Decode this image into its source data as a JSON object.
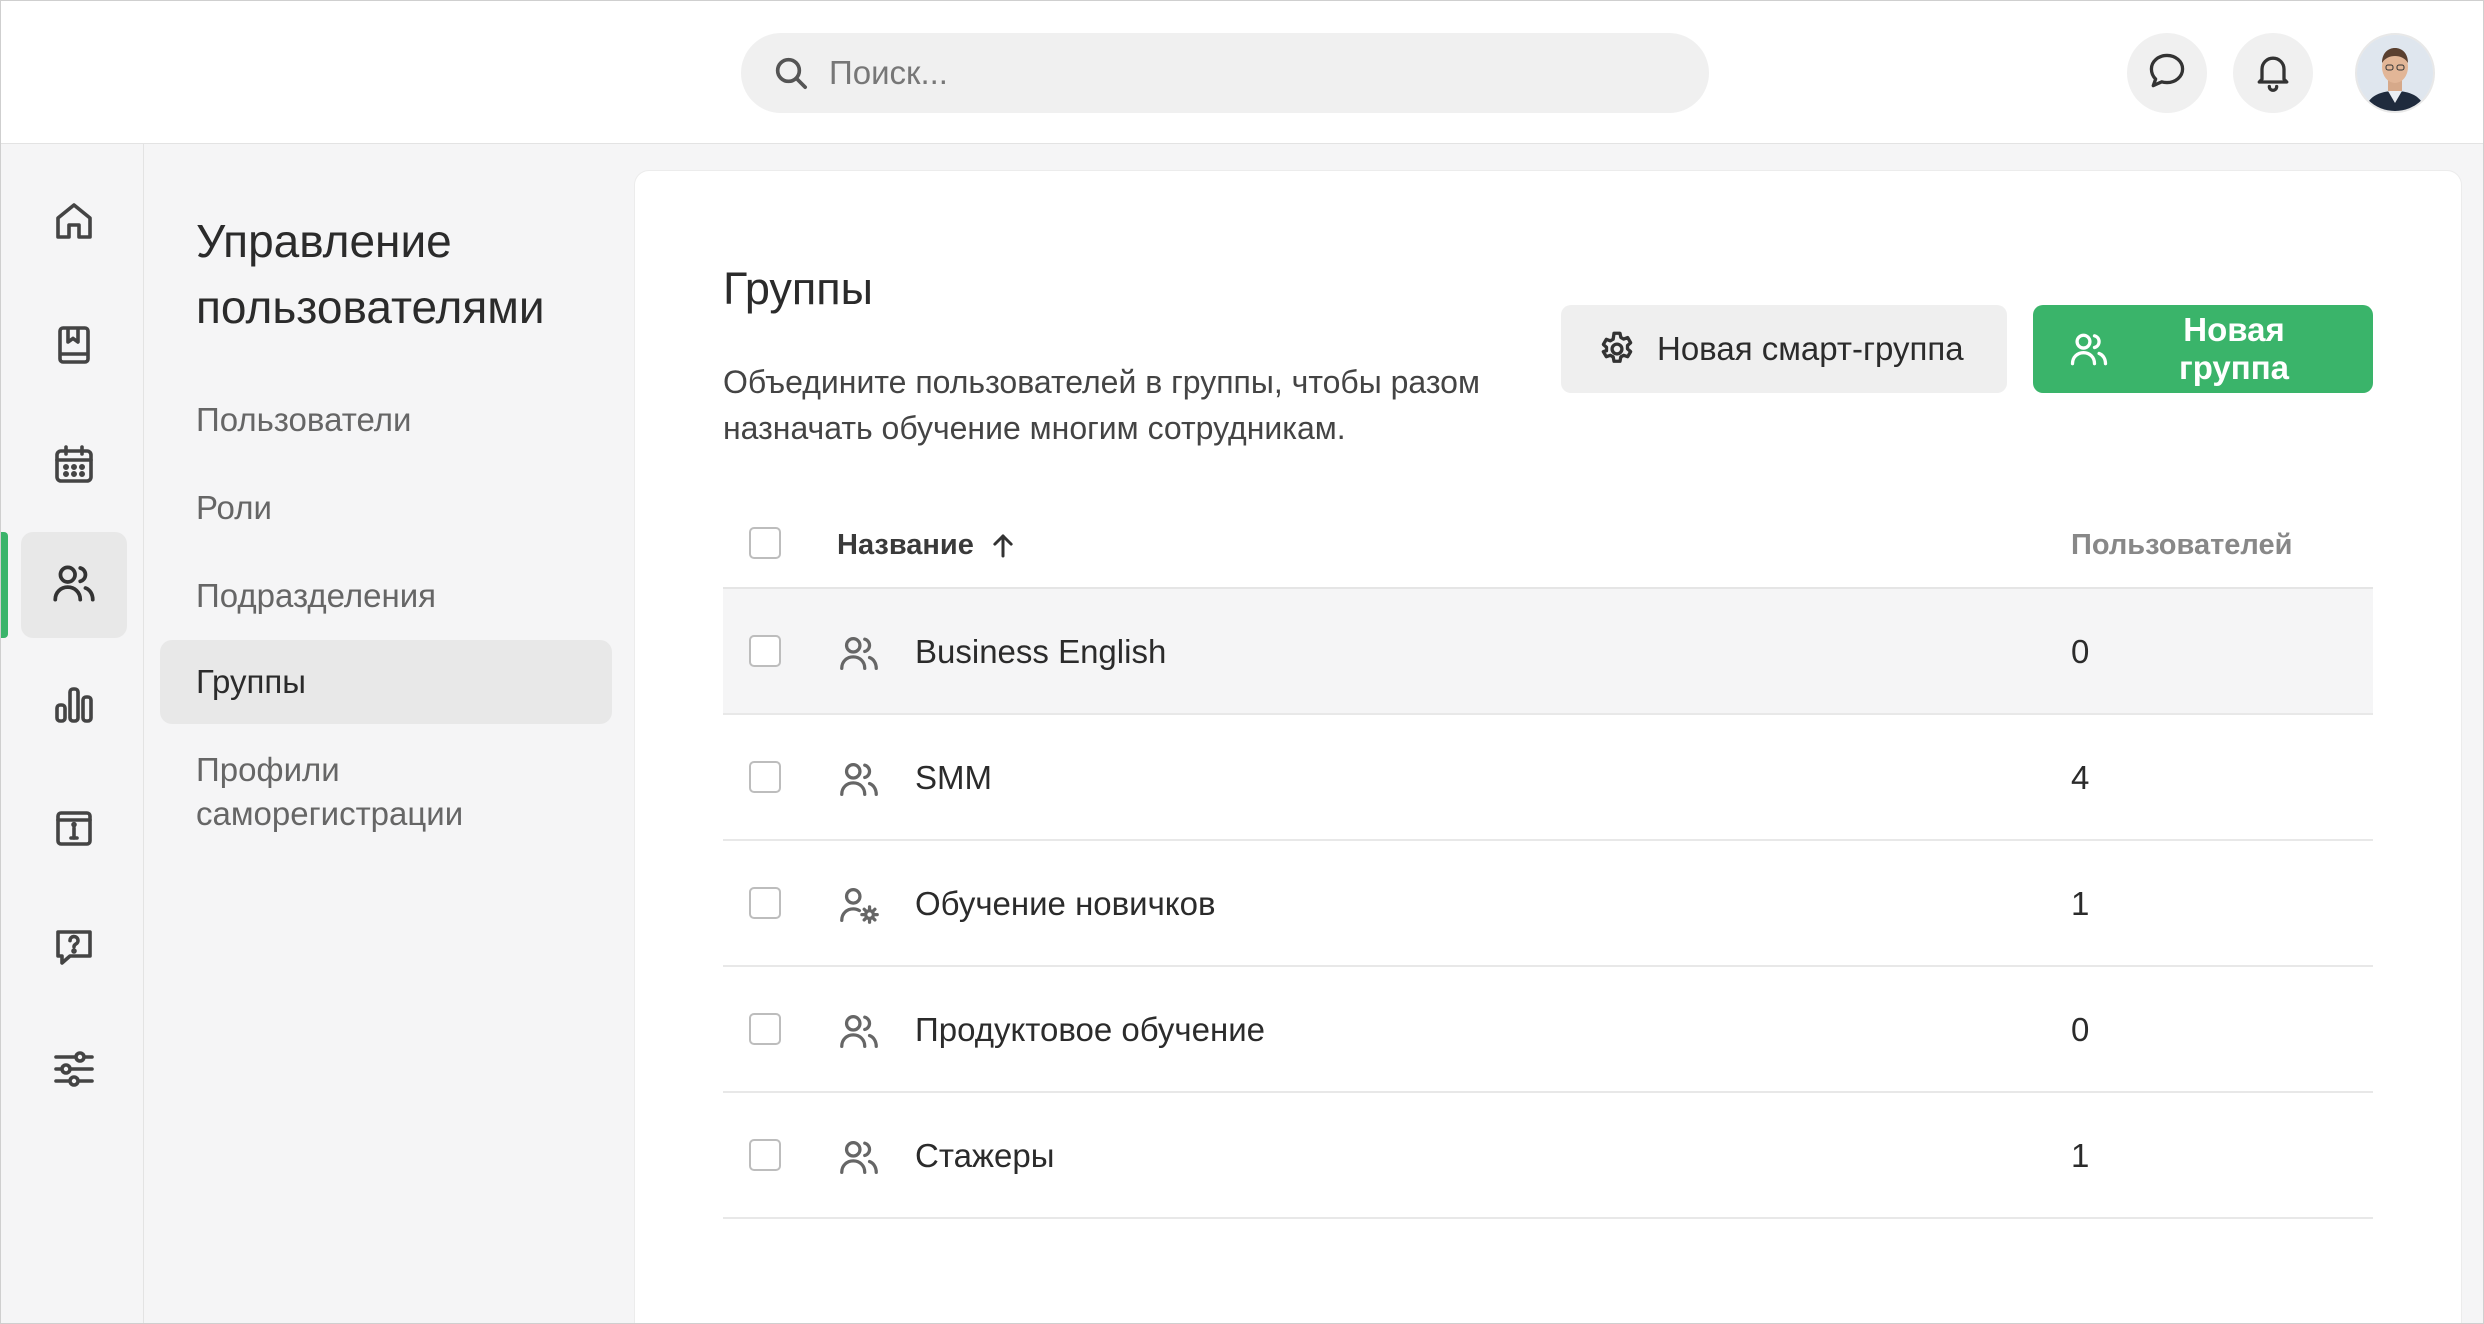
{
  "header": {
    "search_placeholder": "Поиск...",
    "icons": [
      "search-icon",
      "chat-icon",
      "bell-icon",
      "avatar"
    ]
  },
  "rail": {
    "items": [
      {
        "icon": "home-icon"
      },
      {
        "icon": "book-icon"
      },
      {
        "icon": "calendar-icon"
      },
      {
        "icon": "users-icon",
        "active": true
      },
      {
        "icon": "bar-chart-icon"
      },
      {
        "icon": "info-box-icon"
      },
      {
        "icon": "help-chat-icon"
      },
      {
        "icon": "sliders-icon"
      }
    ],
    "accent_color": "#3ab46a"
  },
  "subnav": {
    "title": "Управление пользователями",
    "items": [
      {
        "label": "Пользователи"
      },
      {
        "label": "Роли"
      },
      {
        "label": "Подразделения"
      },
      {
        "label": "Группы",
        "active": true
      },
      {
        "label": "Профили саморегистрации"
      }
    ]
  },
  "main": {
    "title": "Группы",
    "description": "Объедините пользователей в группы, чтобы разом назначать обучение многим сотрудникам.",
    "smart_group_button": "Новая смарт-группа",
    "new_group_button": "Новая группа",
    "table": {
      "col_name": "Название",
      "col_users": "Пользователей",
      "sort": "ascending",
      "rows": [
        {
          "name": "Business English",
          "count": "0",
          "icon": "users-icon"
        },
        {
          "name": "SMM",
          "count": "4",
          "icon": "users-icon"
        },
        {
          "name": "Обучение новичков",
          "count": "1",
          "icon": "user-gear-icon"
        },
        {
          "name": "Продуктовое обучение",
          "count": "0",
          "icon": "users-icon"
        },
        {
          "name": "Стажеры",
          "count": "1",
          "icon": "users-icon"
        }
      ]
    }
  }
}
